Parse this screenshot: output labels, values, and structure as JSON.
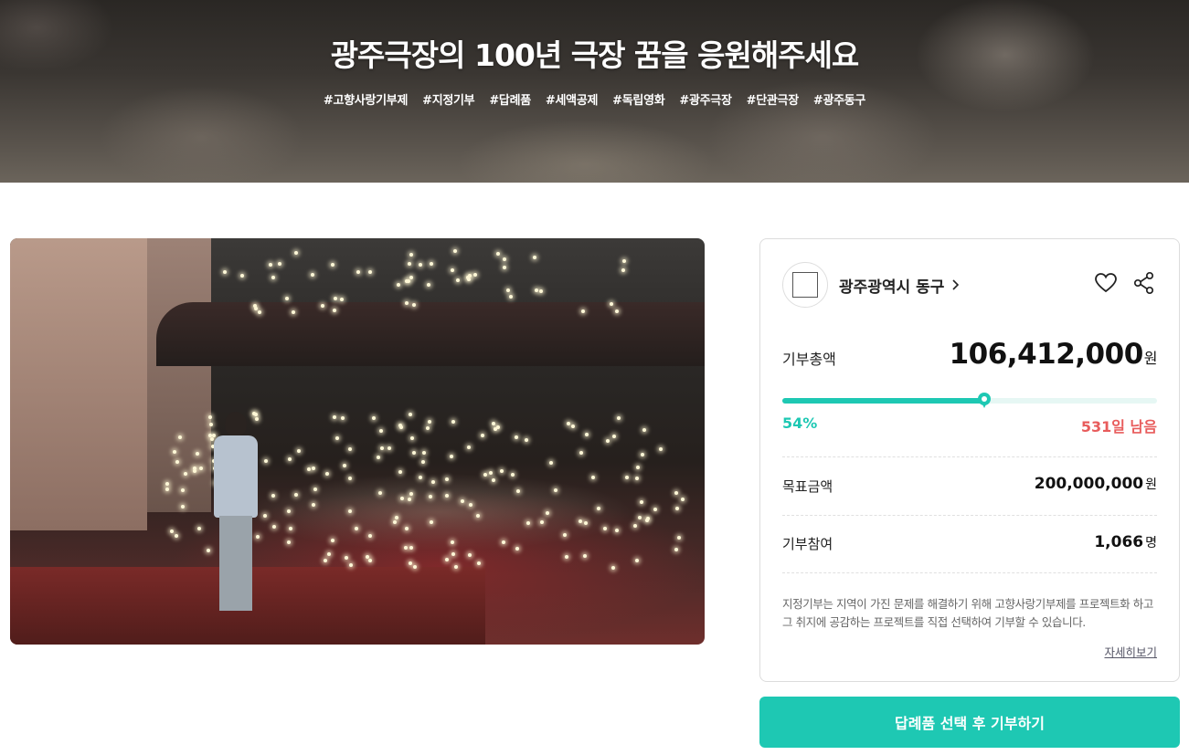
{
  "hero": {
    "title": "광주극장의 100년 극장 꿈을 응원해주세요",
    "tags": [
      "#고향사랑기부제",
      "#지정기부",
      "#답례품",
      "#세액공제",
      "#독립영화",
      "#광주극장",
      "#단관극장",
      "#광주동구"
    ]
  },
  "org": {
    "name": "광주광역시 동구"
  },
  "donation": {
    "total_label": "기부총액",
    "total_value": "106,412,000",
    "total_unit": "원",
    "progress_percent": 54,
    "progress_text": "54%",
    "remaining_text": "531일 남음",
    "goal_label": "목표금액",
    "goal_value": "200,000,000",
    "goal_unit": "원",
    "participants_label": "기부참여",
    "participants_value": "1,066",
    "participants_unit": "명"
  },
  "info": {
    "description": "지정기부는 지역이 가진 문제를 해결하기 위해 고향사랑기부제를 프로젝트화 하고 그 취지에 공감하는 프로젝트를 직접 선택하여 기부할 수 있습니다.",
    "more_link": "자세히보기"
  },
  "cta": {
    "label": "답례품 선택 후 기부하기"
  },
  "colors": {
    "accent": "#1ec8b3",
    "remaining": "#e85c5c"
  },
  "icons": [
    "heart-icon",
    "share-icon",
    "chevron-right-icon"
  ]
}
